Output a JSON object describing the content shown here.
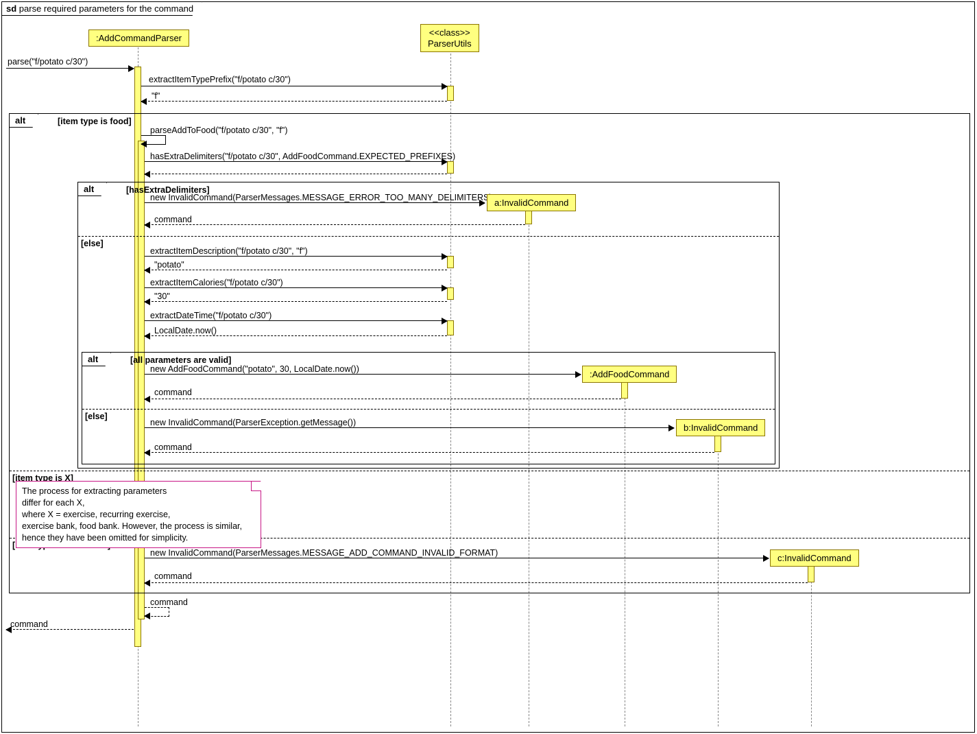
{
  "frame": {
    "kw": "sd",
    "title": "parse required parameters for the command"
  },
  "lifelines": {
    "parser": ":AddCommandParser",
    "utils_stereo": "<<class>>",
    "utils": "ParserUtils",
    "a": "a:InvalidCommand",
    "afc": ":AddFoodCommand",
    "b": "b:InvalidCommand",
    "c": "c:InvalidCommand"
  },
  "messages": {
    "m1": "parse(\"f/potato c/30\")",
    "m2": "extractItemTypePrefix(\"f/potato c/30\")",
    "m3": "\"f\"",
    "m4": "parseAddToFood(\"f/potato c/30\", \"f\")",
    "m5": "hasExtraDelimiters(\"f/potato c/30\", AddFoodCommand.EXPECTED_PREFIXES)",
    "m6": "new InvalidCommand(ParserMessages.MESSAGE_ERROR_TOO_MANY_DELIMITERS)",
    "m7": "command",
    "m8": "extractItemDescription(\"f/potato c/30\", \"f\")",
    "m9": "\"potato\"",
    "m10": "extractItemCalories(\"f/potato c/30\")",
    "m11": "\"30\"",
    "m12": "extractDateTime(\"f/potato c/30\")",
    "m13": "LocalDate.now()",
    "m14": "new AddFoodCommand(\"potato\", 30, LocalDate.now())",
    "m15": "command",
    "m16": "new InvalidCommand(ParserException.getMessage())",
    "m17": "command",
    "m18": "new InvalidCommand(ParserMessages.MESSAGE_ADD_COMMAND_INVALID_FORMAT)",
    "m19": "command",
    "m20": "command",
    "m21": "command"
  },
  "fragments": {
    "alt": "alt",
    "g1": "[item type is food]",
    "g2": "[hasExtraDelimiters]",
    "g3": "[else]",
    "g4": "[all parameters are valid]",
    "g5": "[else]",
    "g6": "[item type is X]",
    "g7": "[item type is not known]"
  },
  "note": {
    "l1": "The process for extracting parameters",
    "l2": "differ for each X,",
    "l3": "where X = exercise, recurring exercise,",
    "l4": "exercise bank, food bank. However, the process is similar,",
    "l5": "hence they have been omitted for simplicity."
  }
}
